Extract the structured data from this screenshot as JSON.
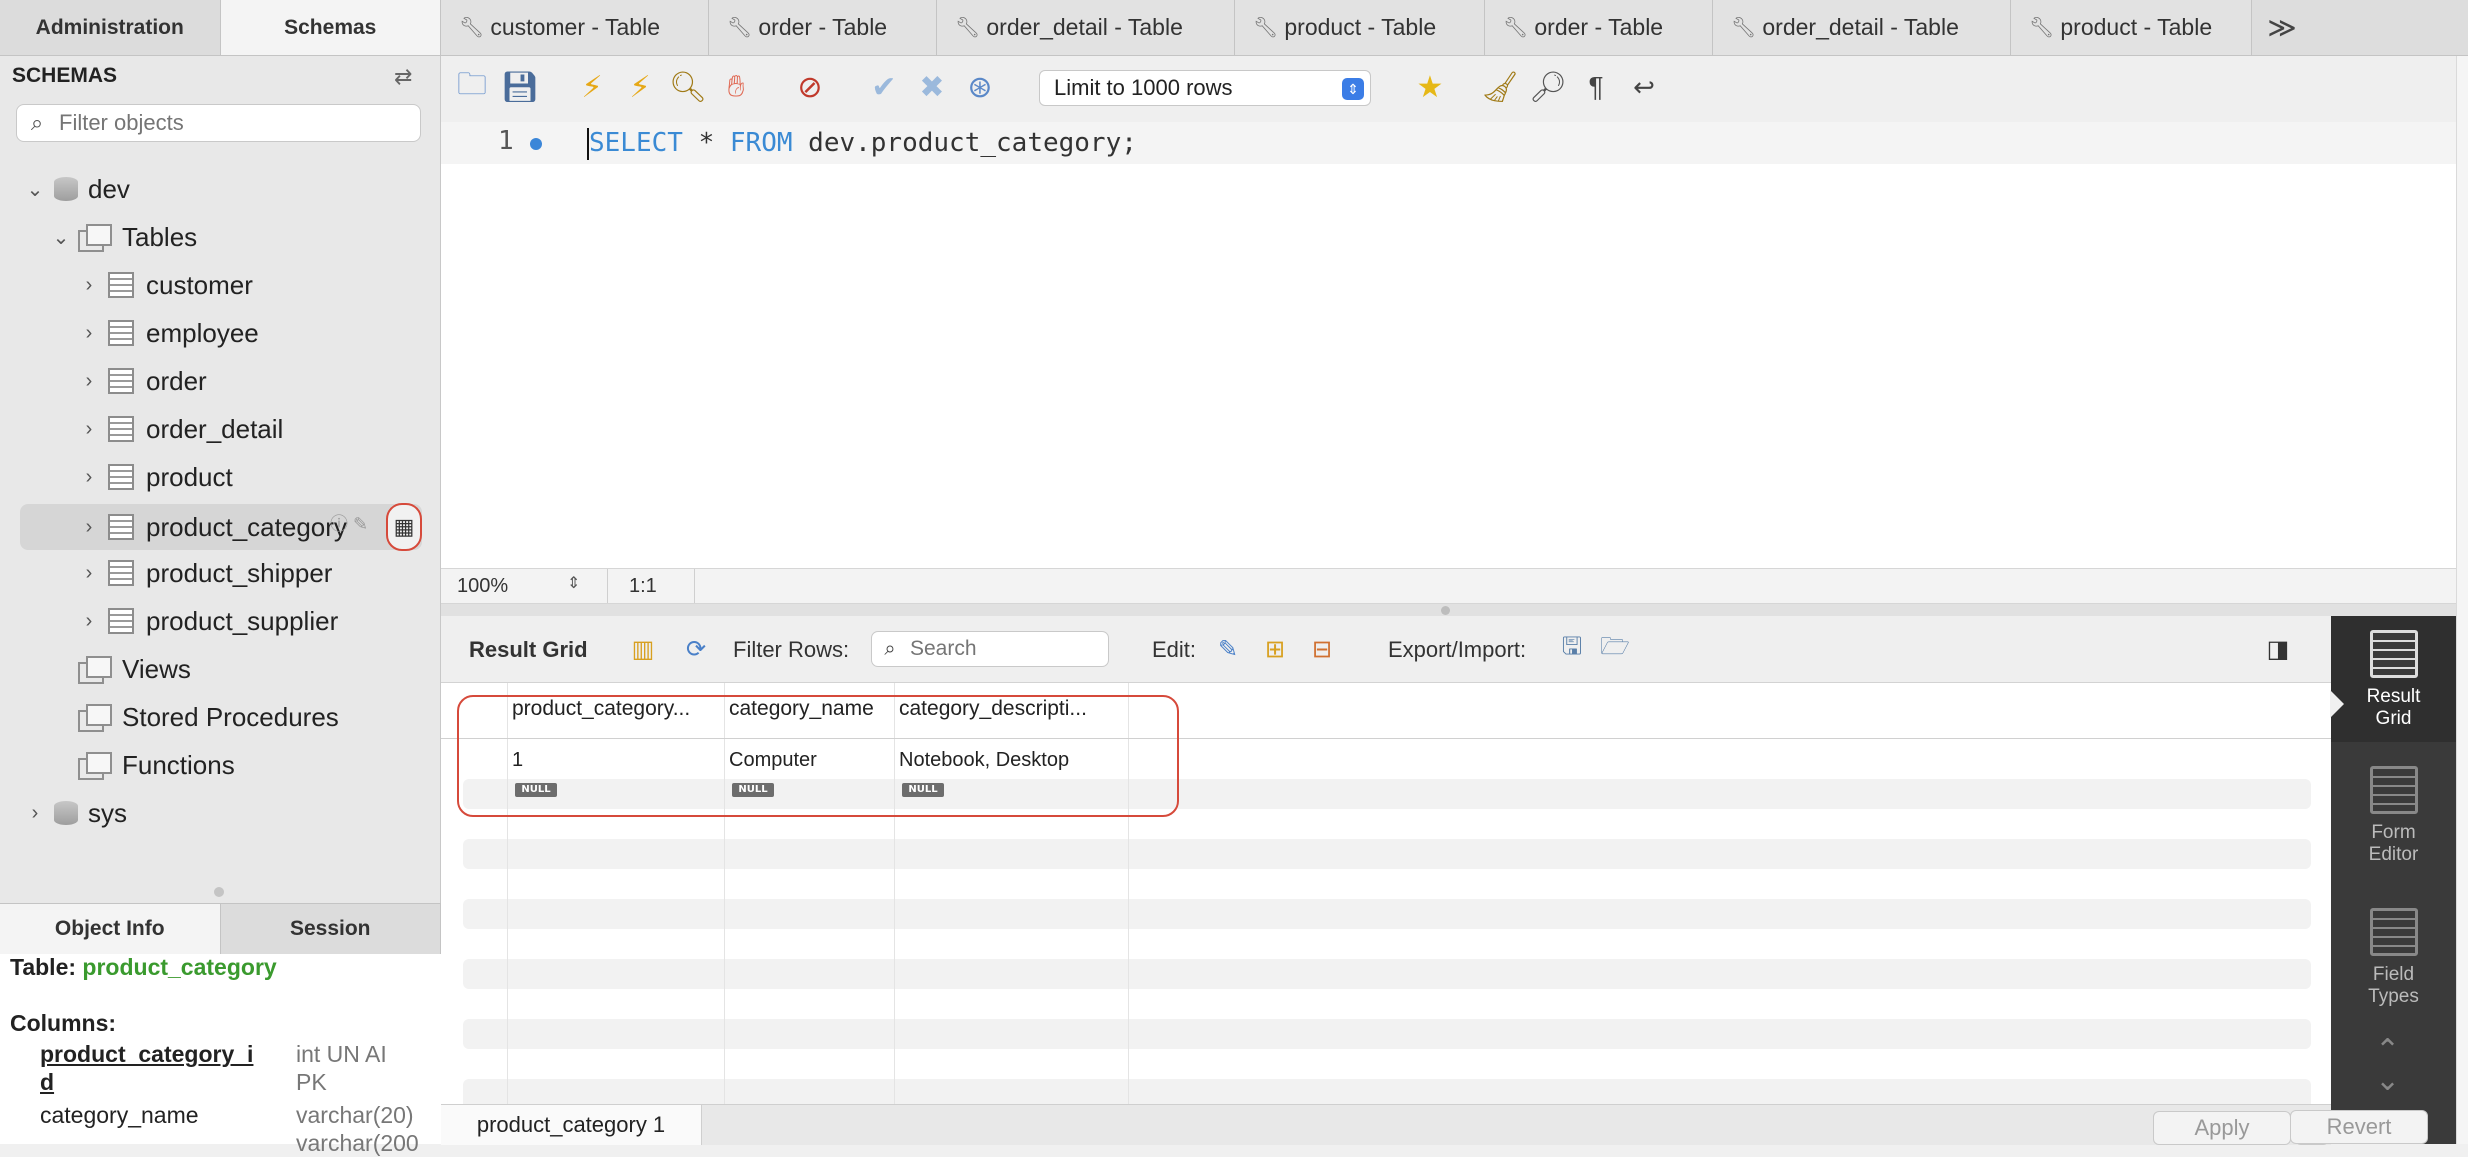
{
  "sidebar": {
    "tabs": [
      "Administration",
      "Schemas"
    ],
    "active_tab": "Schemas",
    "section_title": "SCHEMAS",
    "filter_placeholder": "Filter objects",
    "tree": {
      "db_dev": "dev",
      "tables_folder": "Tables",
      "tables": [
        "customer",
        "employee",
        "order",
        "order_detail",
        "product",
        "product_category",
        "product_shipper",
        "product_supplier"
      ],
      "selected_table": "product_category",
      "views": "Views",
      "stored_procedures": "Stored Procedures",
      "functions": "Functions",
      "db_sys": "sys"
    },
    "info_tabs": [
      "Object Info",
      "Session"
    ],
    "object_info": {
      "table_prefix": "Table:",
      "table_name": "product_category",
      "columns_label": "Columns:",
      "columns": [
        {
          "name_line1": "product_category_i",
          "name_line2": "d",
          "type_line1": "int UN AI",
          "type_line2": "PK"
        },
        {
          "name": "category_name",
          "type": "varchar(20)"
        },
        {
          "name": "",
          "type": "varchar(200"
        }
      ]
    }
  },
  "editor_tabs": [
    "customer - Table",
    "order - Table",
    "order_detail - Table",
    "product - Table",
    "order - Table",
    "order_detail - Table",
    "product - Table"
  ],
  "editor_tabs_more": "≫",
  "toolbar": {
    "limit_label": "Limit to 1000 rows"
  },
  "editor": {
    "line_number": "1",
    "sql_kw1": "SELECT",
    "sql_mid": " * ",
    "sql_kw2": "FROM",
    "sql_rest": " dev.product_category;"
  },
  "editor_status": {
    "zoom": "100%",
    "position": "1:1"
  },
  "result_bar": {
    "result_grid_label": "Result Grid",
    "filter_rows_label": "Filter Rows:",
    "search_placeholder": "Search",
    "edit_label": "Edit:",
    "export_label": "Export/Import:"
  },
  "grid": {
    "columns": [
      "product_category...",
      "category_name",
      "category_descripti..."
    ],
    "rows": [
      [
        "1",
        "Computer",
        "Notebook, Desktop"
      ]
    ],
    "null_label": "NULL"
  },
  "side_panel": {
    "result_grid": [
      "Result",
      "Grid"
    ],
    "form_editor": [
      "Form",
      "Editor"
    ],
    "field_types": [
      "Field",
      "Types"
    ]
  },
  "bottom": {
    "result_tab": "product_category 1",
    "apply": "Apply",
    "revert": "Revert"
  },
  "colors": {
    "accent_blue": "#3a8ad4",
    "annotation_red": "#d64a3b",
    "table_name_green": "#3a9a2e"
  }
}
